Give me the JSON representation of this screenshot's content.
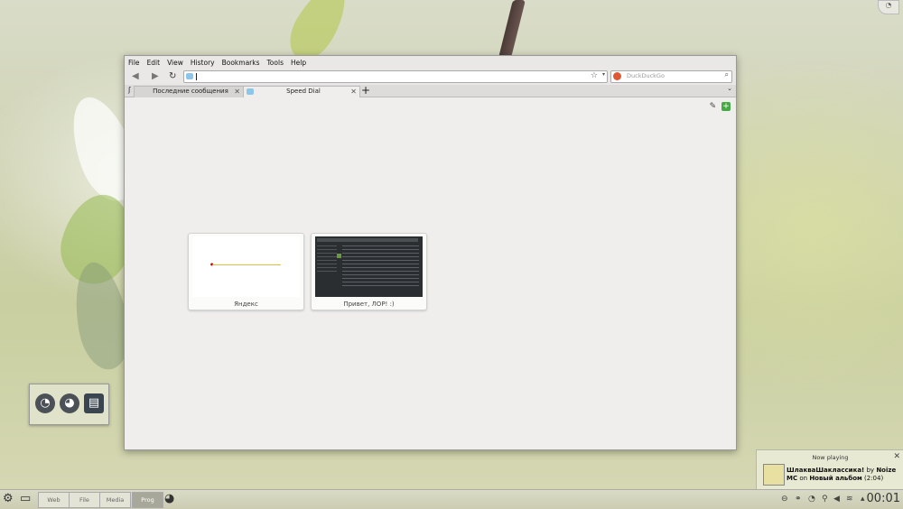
{
  "window": {
    "menu": [
      "File",
      "Edit",
      "View",
      "History",
      "Bookmarks",
      "Tools",
      "Help"
    ],
    "search_placeholder": "DuckDuckGo",
    "tabs": [
      {
        "label": "Последние сообщения"
      },
      {
        "label": "Speed Dial"
      }
    ],
    "speed_dial": [
      {
        "caption": "Яндекс"
      },
      {
        "caption": "Привет, ЛОР! :)"
      }
    ]
  },
  "notification": {
    "title": "Now playing",
    "track": "ШлаквaШаклассика!",
    "by_word": "by",
    "artist": "Noize MC",
    "on_word": "on",
    "album": "Новый альбом",
    "duration": "(2:04)"
  },
  "taskbar": {
    "pagers": [
      "Web",
      "File",
      "Media",
      "Prog"
    ],
    "active_pager": "Prog",
    "clock": "00:01"
  }
}
